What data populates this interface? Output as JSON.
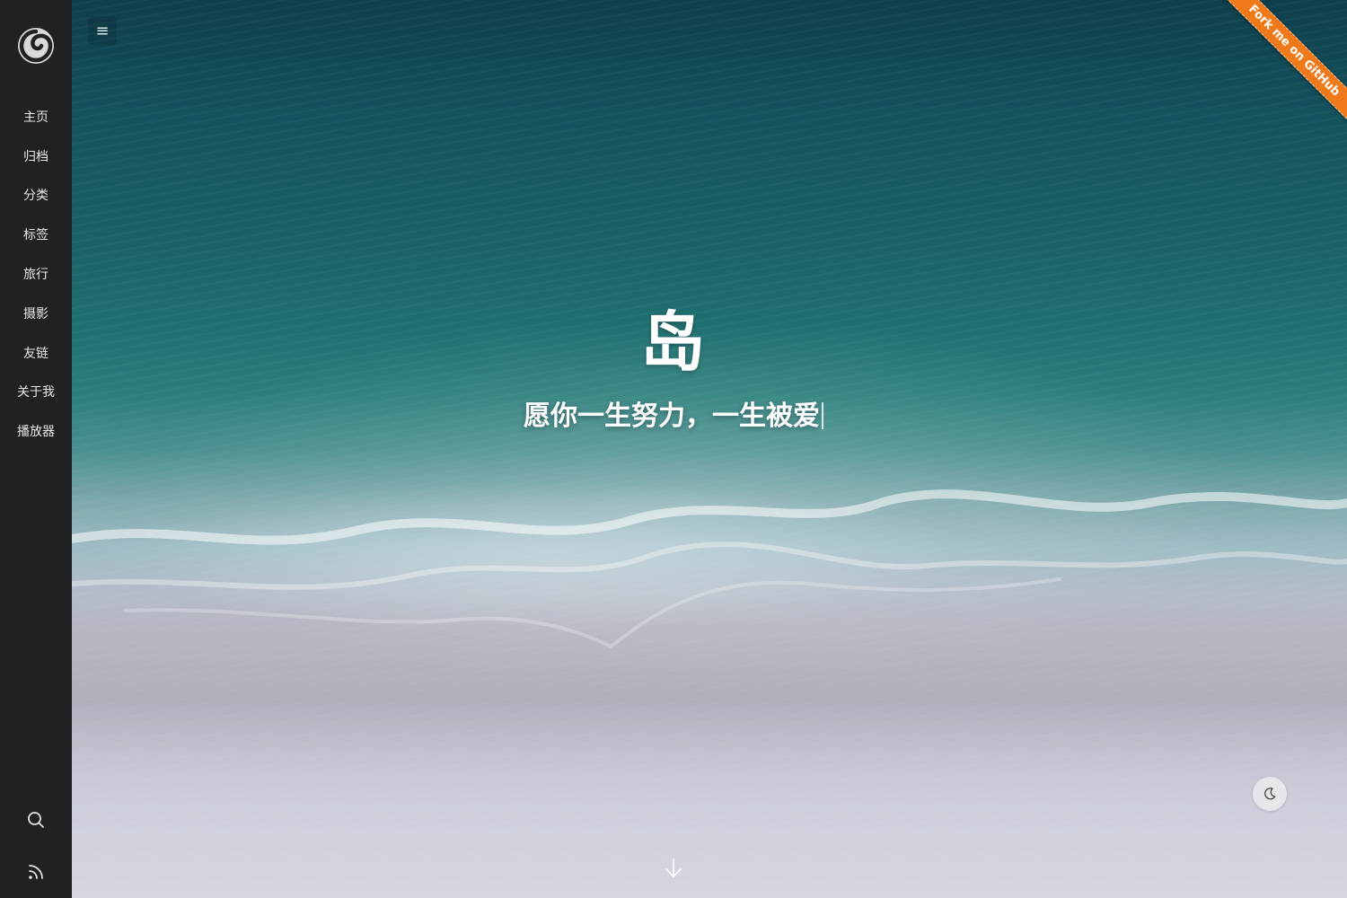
{
  "nav": {
    "items": [
      {
        "label": "主页"
      },
      {
        "label": "归档"
      },
      {
        "label": "分类"
      },
      {
        "label": "标签"
      },
      {
        "label": "旅行"
      },
      {
        "label": "摄影"
      },
      {
        "label": "友链"
      },
      {
        "label": "关于我"
      },
      {
        "label": "播放器"
      }
    ]
  },
  "header": {
    "menu_icon": "≡"
  },
  "hero": {
    "title": "岛",
    "subtitle": "愿你一生努力，一生被爱"
  },
  "ribbon": {
    "label": "Fork me on GitHub"
  },
  "icons": {
    "logo": "swirl-logo-icon",
    "search": "search-icon",
    "rss": "rss-icon",
    "dark_mode": "moon-icon",
    "scroll_down": "arrow-down-icon"
  },
  "colors": {
    "sidebar_bg": "#202124",
    "ribbon": "#f07a1a",
    "nav_text": "#e8e8e8"
  }
}
